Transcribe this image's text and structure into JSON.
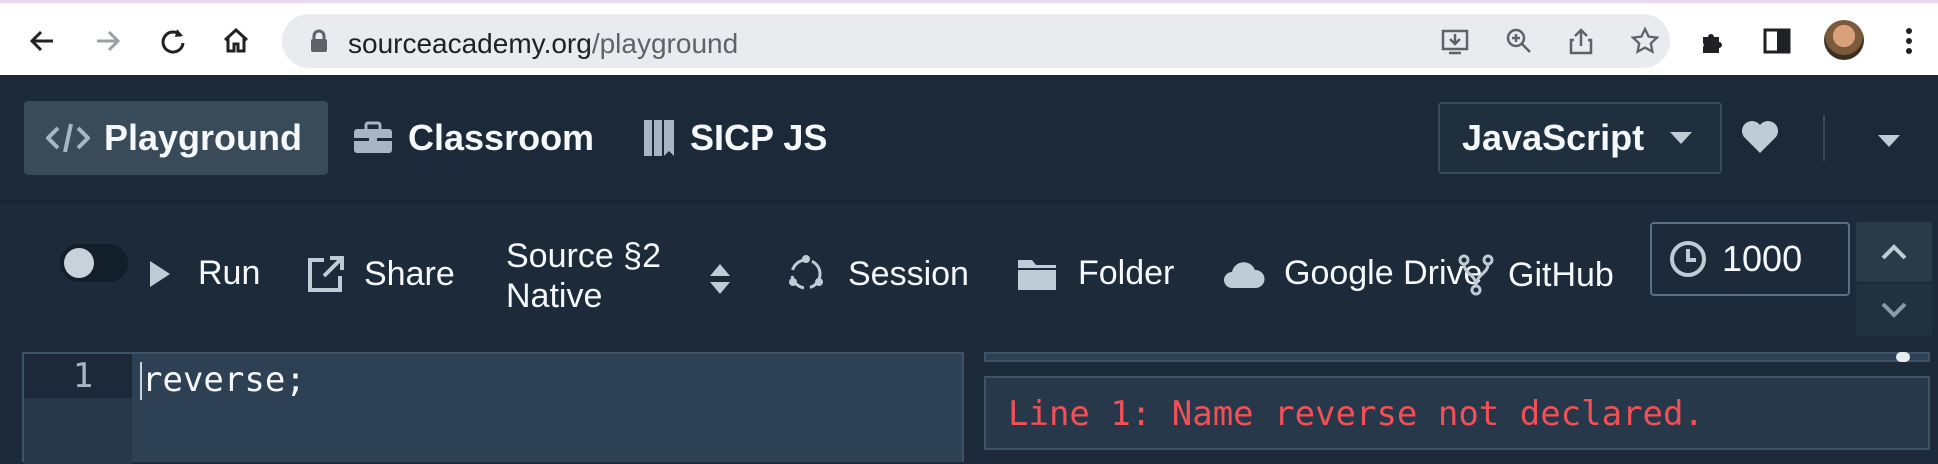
{
  "browser": {
    "url_domain": "sourceacademy.org",
    "url_path": "/playground",
    "icons": [
      "back-icon",
      "forward-icon",
      "reload-icon",
      "home-icon",
      "lock-icon",
      "install-icon",
      "zoom-icon",
      "share-icon",
      "star-icon",
      "extensions-icon",
      "sidebar-icon",
      "profile-avatar",
      "more-icon"
    ]
  },
  "nav": {
    "tabs": [
      {
        "label": "Playground",
        "icon": "code-icon",
        "active": true
      },
      {
        "label": "Classroom",
        "icon": "briefcase-icon",
        "active": false
      },
      {
        "label": "SICP JS",
        "icon": "book-icon",
        "active": false
      }
    ],
    "language": "JavaScript"
  },
  "controls": {
    "run_label": "Run",
    "share_label": "Share",
    "chapter_line1": "Source §2",
    "chapter_line2": "Native",
    "session_label": "Session",
    "folder_label": "Folder",
    "google_drive_label": "Google Drive",
    "github_label": "GitHub",
    "timeout_value": "1000"
  },
  "editor": {
    "line_numbers": [
      "1"
    ],
    "code": "reverse;"
  },
  "repl": {
    "error_message": "Line 1: Name reverse not declared."
  },
  "colors": {
    "background": "#1c2a39",
    "active_tab": "#394b59",
    "error_text": "#f05056"
  }
}
